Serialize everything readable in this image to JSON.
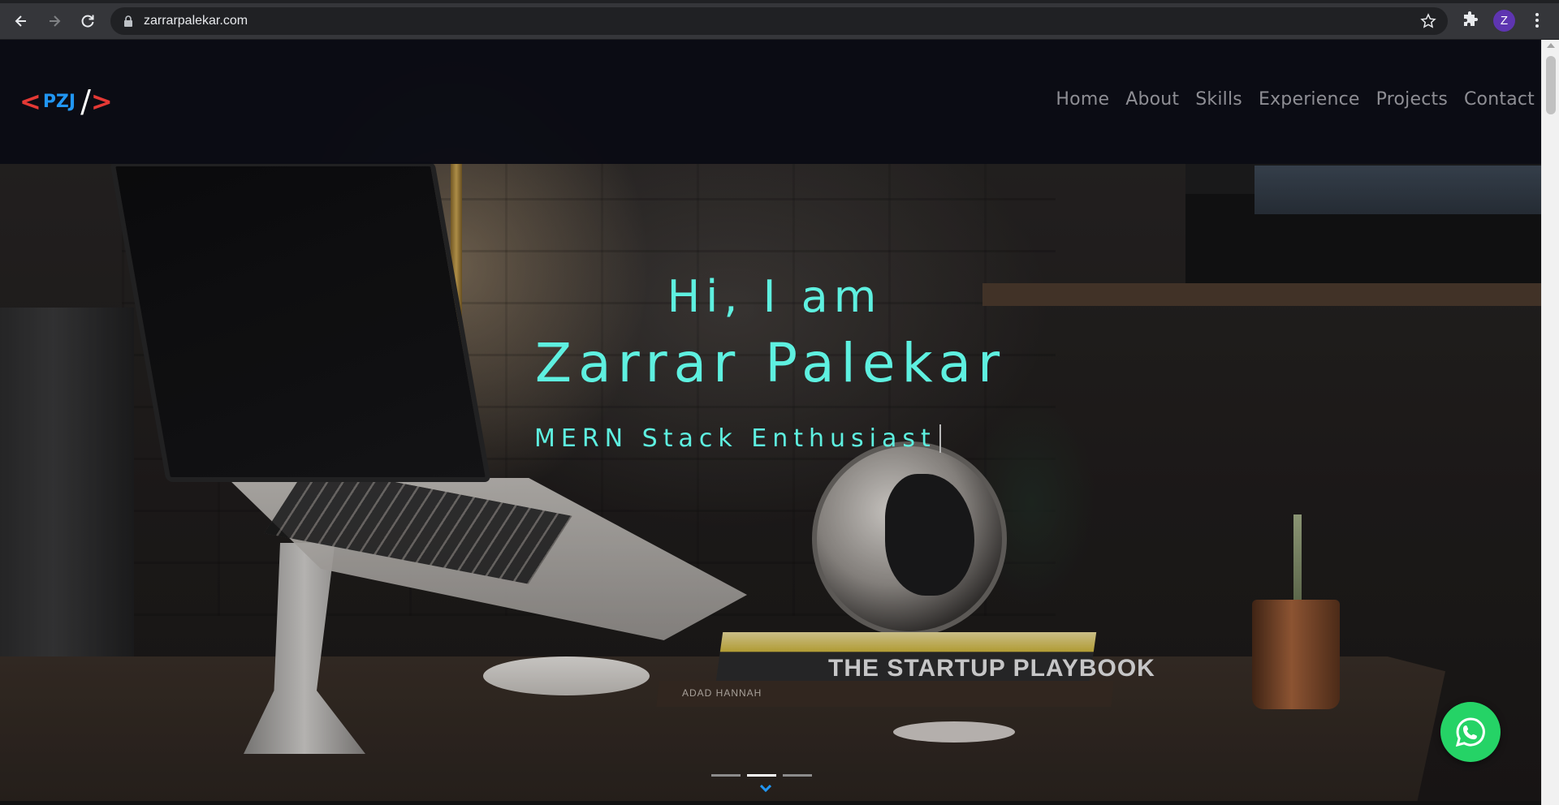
{
  "browser": {
    "url": "zarrarpalekar.com",
    "profile_initial": "Z",
    "icons": {
      "back": "arrow-left-icon",
      "forward": "arrow-right-icon",
      "reload": "reload-icon",
      "lock": "lock-icon",
      "bookmark": "star-icon",
      "extensions": "puzzle-icon",
      "menu": "kebab-menu-icon"
    }
  },
  "site": {
    "logo": {
      "open": "<",
      "text": "PZJ",
      "slash": "/",
      "close": ">"
    },
    "nav": [
      "Home",
      "About",
      "Skills",
      "Experience",
      "Projects",
      "Contact"
    ],
    "colors": {
      "accent": "#5ef0e0",
      "logo_bracket": "#e53935",
      "logo_text": "#2196f3",
      "whatsapp": "#25d366"
    }
  },
  "hero": {
    "greeting": "Hi, I am",
    "name": "Zarrar Palekar",
    "role": "MERN Stack Enthusiast",
    "carousel": {
      "slides": 3,
      "active_index": 1
    }
  },
  "scene": {
    "book_title": "THE STARTUP PLAYBOOK",
    "book_author": "ADAD HANNAH"
  }
}
